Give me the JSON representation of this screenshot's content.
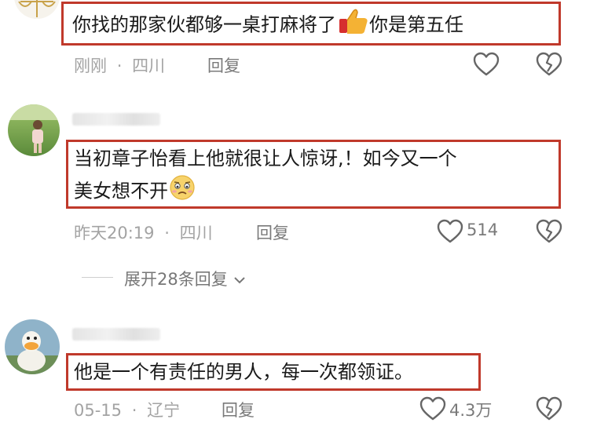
{
  "comments": [
    {
      "text_part1": "你找的那家伙都够一桌打麻将了",
      "text_part2": "你是第五任",
      "emoji": "thumbs-up-icon",
      "time": "刚刚",
      "location": "四川",
      "reply": "回复",
      "likes": ""
    },
    {
      "line1": "当初章子怡看上他就很让人惊讶,！如今又一个",
      "line2": "美女想不开",
      "emoji": "worried-face-icon",
      "time": "昨天20:19",
      "location": "四川",
      "reply": "回复",
      "likes": "514",
      "expand": "展开28条回复"
    },
    {
      "text": "他是一个有责任的男人，每一次都领证。",
      "time": "05-15",
      "location": "辽宁",
      "reply": "回复",
      "likes": "4.3万"
    }
  ],
  "separator": "·",
  "colors": {
    "highlight": "#c0392b",
    "meta": "#a3a3a3"
  }
}
